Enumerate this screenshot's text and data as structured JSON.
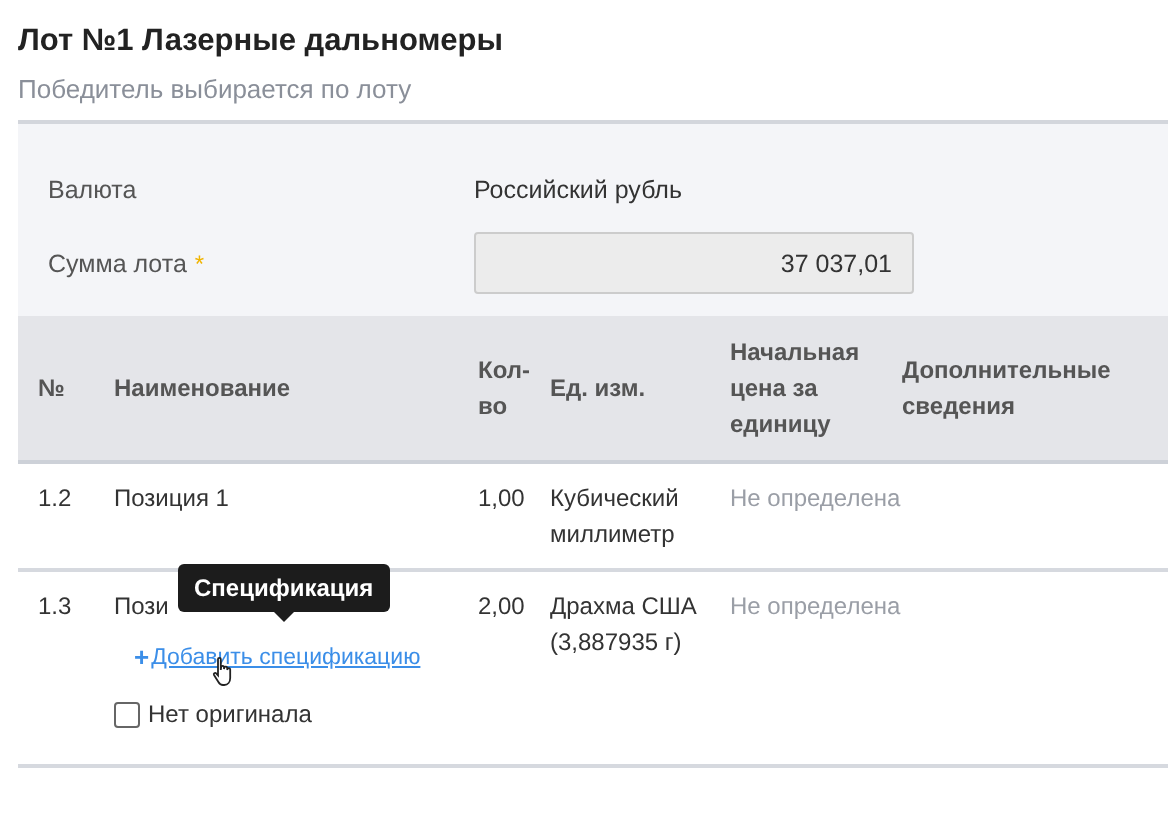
{
  "lot": {
    "title": "Лот №1 Лазерные дальномеры",
    "subtitle": "Победитель выбирается по лоту"
  },
  "fields": [
    {
      "label": "Валюта",
      "kind": "text",
      "value": "Российский рубль"
    },
    {
      "label": "Сумма лота",
      "required_mark": "*",
      "kind": "input",
      "value": "37 037,01"
    }
  ],
  "table": {
    "columns": [
      "№",
      "Наименование",
      "Кол-во",
      "Ед. изм.",
      "Начальная цена за единицу",
      "Дополнительные сведения"
    ],
    "rows": [
      {
        "number": "1.2",
        "name": "Позиция 1",
        "quantity": "1,00",
        "unit": "Кубический миллиметр",
        "price": "Не определена"
      },
      {
        "number": "1.3",
        "name": "Пози",
        "quantity": "2,00",
        "unit": "Драхма США (3,887935 г)",
        "price": "Не определена",
        "tooltip": "Спецификация",
        "add_link": {
          "icon": "+",
          "label": "Добавить спецификацию"
        },
        "checkbox": {
          "label": "Нет оригинала",
          "checked": false
        }
      }
    ]
  }
}
